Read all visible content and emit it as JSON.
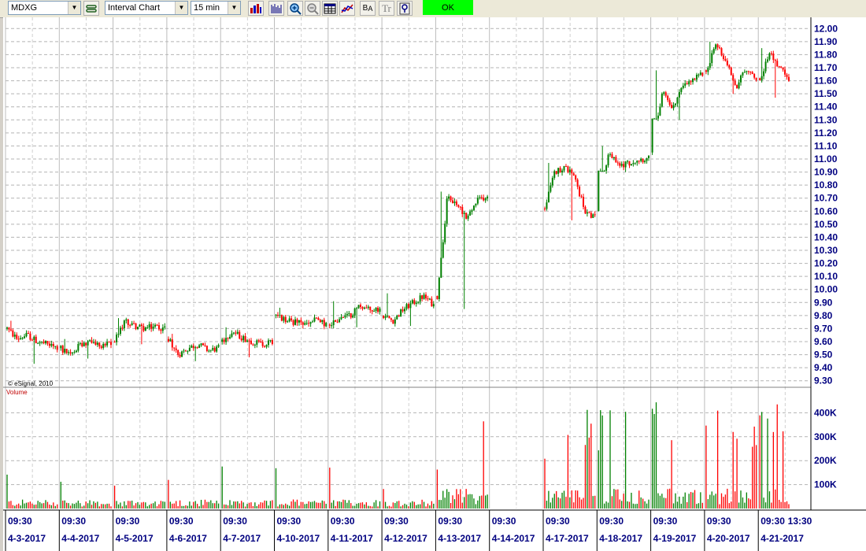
{
  "toolbar": {
    "symbol": "MDXG",
    "chart_type": "Interval Chart",
    "interval": "15 min",
    "ok_label": "OK",
    "icons": [
      "link-icon",
      "bar-chart-icon",
      "volume-icon",
      "zoom-in-icon",
      "zoom-out-icon",
      "table-icon",
      "line-study-icon",
      "buy-ask-icon",
      "text-tool-icon",
      "cursor-icon"
    ]
  },
  "chart_data": {
    "type": "candlestick",
    "price_axis_labels": [
      "12.00",
      "11.90",
      "11.80",
      "11.70",
      "11.60",
      "11.50",
      "11.40",
      "11.30",
      "11.20",
      "11.10",
      "11.00",
      "10.90",
      "10.80",
      "10.70",
      "10.60",
      "10.50",
      "10.40",
      "10.30",
      "10.20",
      "10.10",
      "10.00",
      "9.90",
      "9.80",
      "9.70",
      "9.60",
      "9.50",
      "9.40",
      "9.30"
    ],
    "price_range": [
      9.25,
      12.05
    ],
    "volume_axis_labels": [
      "400K",
      "300K",
      "200K",
      "100K"
    ],
    "volume_range": [
      0,
      500000
    ],
    "volume_label": "Volume",
    "copyright": "© eSignal, 2010",
    "sessions": [
      {
        "date": "4-3-2017",
        "time": "09:30",
        "open": 9.7,
        "close": 9.55,
        "high": 9.76,
        "low": 9.43,
        "path": [
          9.7,
          9.62,
          9.65,
          9.6,
          9.58,
          9.55
        ]
      },
      {
        "date": "4-4-2017",
        "time": "09:30",
        "open": 9.55,
        "close": 9.58,
        "high": 9.62,
        "low": 9.47,
        "path": [
          9.55,
          9.5,
          9.58,
          9.6,
          9.57,
          9.58
        ]
      },
      {
        "date": "4-5-2017",
        "time": "09:30",
        "open": 9.6,
        "close": 9.7,
        "high": 9.78,
        "low": 9.58,
        "path": [
          9.6,
          9.76,
          9.72,
          9.7,
          9.72,
          9.7
        ]
      },
      {
        "date": "4-6-2017",
        "time": "09:30",
        "open": 9.62,
        "close": 9.55,
        "high": 9.66,
        "low": 9.45,
        "path": [
          9.62,
          9.5,
          9.55,
          9.58,
          9.53,
          9.55
        ]
      },
      {
        "date": "4-7-2017",
        "time": "09:30",
        "open": 9.6,
        "close": 9.6,
        "high": 9.71,
        "low": 9.48,
        "path": [
          9.6,
          9.68,
          9.63,
          9.6,
          9.58,
          9.6
        ]
      },
      {
        "date": "4-10-2017",
        "time": "09:30",
        "open": 9.8,
        "close": 9.73,
        "high": 9.86,
        "low": 9.7,
        "path": [
          9.8,
          9.76,
          9.75,
          9.73,
          9.77,
          9.73
        ]
      },
      {
        "date": "4-11-2017",
        "time": "09:30",
        "open": 9.73,
        "close": 9.85,
        "high": 9.91,
        "low": 9.71,
        "path": [
          9.73,
          9.78,
          9.8,
          9.88,
          9.84,
          9.85
        ]
      },
      {
        "date": "4-12-2017",
        "time": "09:30",
        "open": 9.8,
        "close": 9.95,
        "high": 9.97,
        "low": 9.72,
        "path": [
          9.8,
          9.76,
          9.85,
          9.9,
          9.95,
          9.88
        ]
      },
      {
        "date": "4-13-2017",
        "time": "09:30",
        "open": 9.95,
        "close": 10.72,
        "high": 10.75,
        "low": 9.85,
        "path": [
          9.95,
          10.7,
          10.65,
          10.55,
          10.68,
          10.72
        ]
      },
      {
        "date": "4-14-2017",
        "time": "09:30",
        "closed": true
      },
      {
        "date": "4-17-2017",
        "time": "09:30",
        "open": 10.62,
        "close": 10.6,
        "high": 10.97,
        "low": 10.53,
        "path": [
          10.62,
          10.9,
          10.94,
          10.85,
          10.6,
          10.55
        ]
      },
      {
        "date": "4-18-2017",
        "time": "09:30",
        "open": 10.6,
        "close": 11.0,
        "high": 11.1,
        "low": 10.9,
        "path": [
          10.6,
          11.05,
          10.95,
          10.97,
          11.0,
          11.0
        ]
      },
      {
        "date": "4-19-2017",
        "time": "09:30",
        "open": 11.05,
        "close": 11.55,
        "high": 11.68,
        "low": 11.3,
        "path": [
          11.05,
          11.52,
          11.4,
          11.55,
          11.6,
          11.65
        ]
      },
      {
        "date": "4-20-2017",
        "time": "09:30",
        "open": 11.68,
        "close": 11.6,
        "high": 11.9,
        "low": 11.5,
        "path": [
          11.68,
          11.88,
          11.75,
          11.55,
          11.7,
          11.6
        ]
      },
      {
        "date": "4-21-2017",
        "time": "09:30",
        "open": 11.62,
        "close": 11.53,
        "high": 11.85,
        "low": 11.47,
        "path": [
          11.62,
          11.82,
          11.7,
          11.6,
          11.55,
          11.53
        ],
        "partial": true,
        "last_time": "13:30"
      }
    ],
    "colors": {
      "up": "#008000",
      "down": "#ff0000",
      "grid": "#b4b4b4",
      "axis_text": "#000080"
    }
  }
}
